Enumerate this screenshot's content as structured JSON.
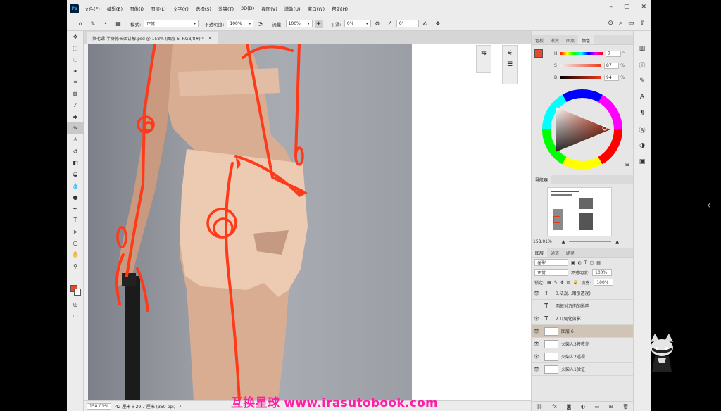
{
  "menu": {
    "logo": "Ps",
    "items": [
      "文件(F)",
      "编辑(E)",
      "图像(I)",
      "图层(L)",
      "文字(Y)",
      "选择(S)",
      "滤镜(T)",
      "3D(D)",
      "视图(V)",
      "增效(U)",
      "窗口(W)",
      "帮助(H)"
    ],
    "window_controls": [
      "–",
      "□",
      "✕"
    ]
  },
  "options_bar": {
    "mode_label": "模式:",
    "mode_value": "正常",
    "opacity_label": "不透明度:",
    "opacity_value": "100%",
    "flow_label": "流量:",
    "flow_value": "100%",
    "smoothing_label": "平滑:",
    "smoothing_value": "0%",
    "angle_value": "0°"
  },
  "document": {
    "tab_title": "第七课-半身修长面讲解.psd @ 158% (图层 6, RGB/8#) *",
    "close_glyph": "×"
  },
  "status": {
    "zoom": "158.01%",
    "size": "42 厘米 x 29.7 厘米 (350 ppi)"
  },
  "color_panel": {
    "tabs": [
      "色板",
      "渐变",
      "图案",
      "颜色"
    ],
    "active_tab": "颜色",
    "h_label": "H",
    "h_value": "7",
    "s_label": "S",
    "s_value": "87",
    "b_label": "B",
    "b_value": "94",
    "unit_deg": "°",
    "unit_pct": "%",
    "foreground_color": "#e64a2e"
  },
  "navigator": {
    "title": "导航器",
    "zoom": "158.01%"
  },
  "layers_panel": {
    "tabs": [
      "图层",
      "通道",
      "路径"
    ],
    "active_tab": "图层",
    "kind_label": "类型",
    "blend_mode": "正常",
    "opacity_label": "不透明度:",
    "opacity_value": "100%",
    "lock_label": "锁定:",
    "fill_label": "填充:",
    "fill_value": "100%",
    "layers": [
      {
        "name": "3.法规...暗示透视)",
        "type": "T",
        "visible": true
      },
      {
        "name": "两根对方向的影响",
        "type": "T",
        "visible": false
      },
      {
        "name": "2.几何化剪影",
        "type": "T",
        "visible": true
      },
      {
        "name": "图层 6",
        "type": "",
        "visible": true,
        "selected": true
      },
      {
        "name": "火柴人3将教你",
        "type": "",
        "visible": true
      },
      {
        "name": "火柴人2透视",
        "type": "",
        "visible": true
      },
      {
        "name": "火柴人1验证",
        "type": "",
        "visible": true
      }
    ],
    "footer_icons": [
      "link-icon",
      "fx-icon",
      "mask-icon",
      "adjustment-icon",
      "folder-icon",
      "new-layer-icon",
      "trash-icon"
    ]
  },
  "watermark": "互换星球 www.irasutobook.com"
}
